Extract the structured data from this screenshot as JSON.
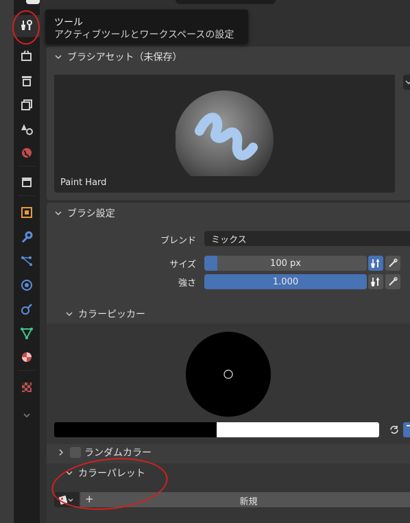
{
  "tooltip": {
    "title": "ツール",
    "description": "アクティブツールとワークスペースの設定"
  },
  "brush_preset_panel": {
    "title": "ブラシアセット（未保存）",
    "brush_name": "Paint Hard"
  },
  "brush_settings_panel": {
    "title": "ブラシ設定",
    "blend_label": "ブレンド",
    "blend_value": "ミックス",
    "size_label": "サイズ",
    "size_value": "100 px",
    "size_fill": 0.08,
    "strength_label": "強さ",
    "strength_value": "1.000",
    "strength_fill": 1.0
  },
  "color_picker": {
    "title": "カラーピッカー",
    "primary_color": "#000000",
    "secondary_color": "#ffffff"
  },
  "random_color": {
    "label": "ランダムカラー",
    "checked": false
  },
  "color_palette": {
    "title": "カラーパレット",
    "new_label": "新規",
    "add_symbol": "+"
  },
  "colors": {
    "accent": "#4772b3",
    "annotation": "#d42020"
  }
}
